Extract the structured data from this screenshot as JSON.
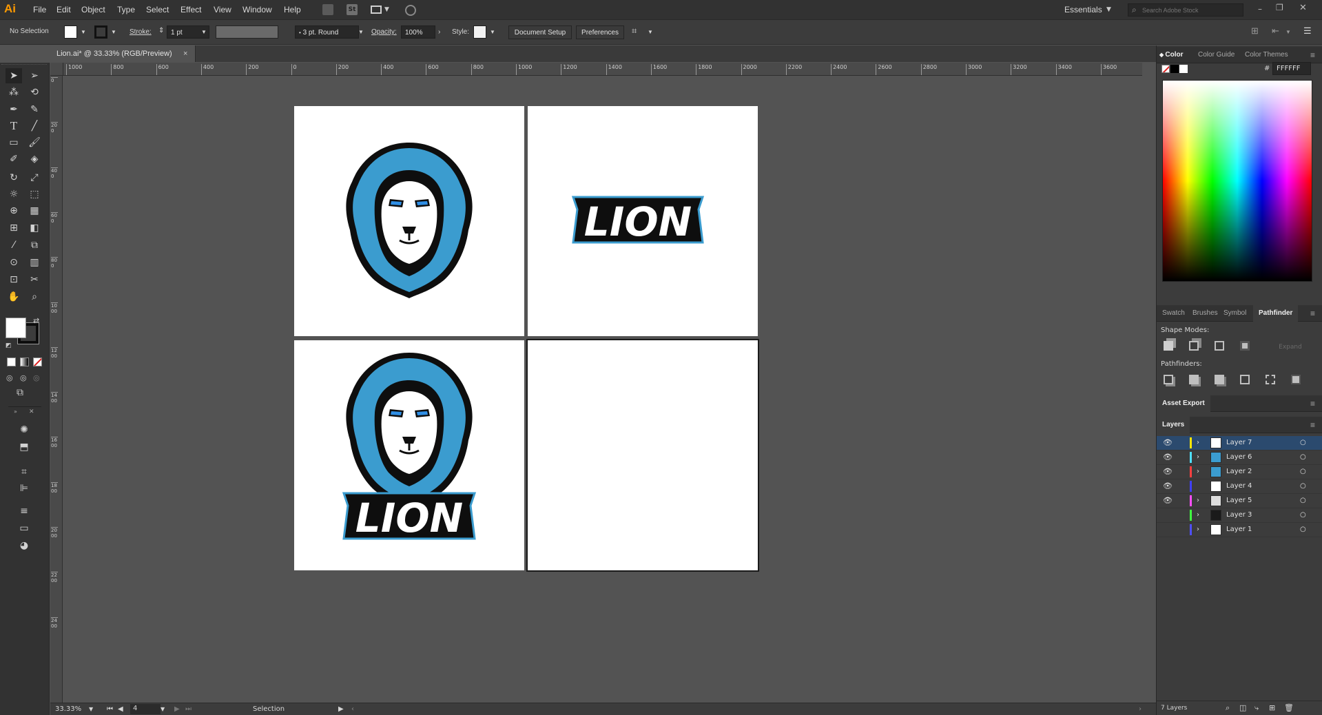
{
  "app": {
    "logo": "Ai"
  },
  "menu": [
    "File",
    "Edit",
    "Object",
    "Type",
    "Select",
    "Effect",
    "View",
    "Window",
    "Help"
  ],
  "workspace": "Essentials",
  "search": {
    "placeholder": "Search Adobe Stock"
  },
  "control": {
    "selection": "No Selection",
    "stroke_label": "Stroke:",
    "stroke_value": "1 pt",
    "brush": "3 pt. Round",
    "opacity_label": "Opacity:",
    "opacity_value": "100%",
    "style_label": "Style:",
    "document_setup": "Document Setup",
    "preferences": "Preferences"
  },
  "document_tab": {
    "title": "Lion.ai* @ 33.33% (RGB/Preview)",
    "close": "×"
  },
  "ruler": {
    "h_labels": [
      "1000",
      "800",
      "600",
      "400",
      "200",
      "0",
      "200",
      "400",
      "600",
      "800",
      "1000",
      "1200",
      "1400",
      "1600",
      "1800",
      "2000",
      "2200",
      "2400",
      "2600",
      "2800",
      "3000",
      "3200",
      "3400",
      "3600"
    ],
    "v_labels": [
      "0",
      "200",
      "400",
      "600",
      "800",
      "1000",
      "1200",
      "1400",
      "1600",
      "1800",
      "2000",
      "2200",
      "2400"
    ]
  },
  "artwork": {
    "wordmark": "LION"
  },
  "status": {
    "zoom": "33.33%",
    "artboard": "4",
    "tool": "Selection"
  },
  "color_panel": {
    "tabs": [
      "Color",
      "Color Guide",
      "Color Themes"
    ],
    "hash": "#",
    "hex": "FFFFFF"
  },
  "pathfinder_panel": {
    "tabs": [
      "Swatch",
      "Brushes",
      "Symbol",
      "Pathfinder"
    ],
    "shape_modes": "Shape Modes:",
    "expand": "Expand",
    "pathfinders": "Pathfinders:"
  },
  "asset_export": {
    "title": "Asset Export"
  },
  "layers": {
    "title": "Layers",
    "count": "7 Layers",
    "rows": [
      {
        "name": "Layer 7",
        "color": "#ffe600",
        "visible": true,
        "expand": true,
        "selected": true
      },
      {
        "name": "Layer 6",
        "color": "#4fe0ff",
        "visible": true,
        "expand": true,
        "selected": false
      },
      {
        "name": "Layer 2",
        "color": "#ff4040",
        "visible": true,
        "expand": true,
        "selected": false
      },
      {
        "name": "Layer 4",
        "color": "#4040ff",
        "visible": true,
        "expand": false,
        "selected": false
      },
      {
        "name": "Layer 5",
        "color": "#ff4fff",
        "visible": true,
        "expand": true,
        "selected": false
      },
      {
        "name": "Layer 3",
        "color": "#40ff40",
        "visible": false,
        "expand": true,
        "selected": false
      },
      {
        "name": "Layer 1",
        "color": "#4f4fff",
        "visible": false,
        "expand": true,
        "selected": false
      }
    ]
  },
  "colors": {
    "accent_orange": "#ff9a00",
    "lion_blue": "#3b9ccf",
    "lion_eye_blue": "#2f8fe6"
  }
}
